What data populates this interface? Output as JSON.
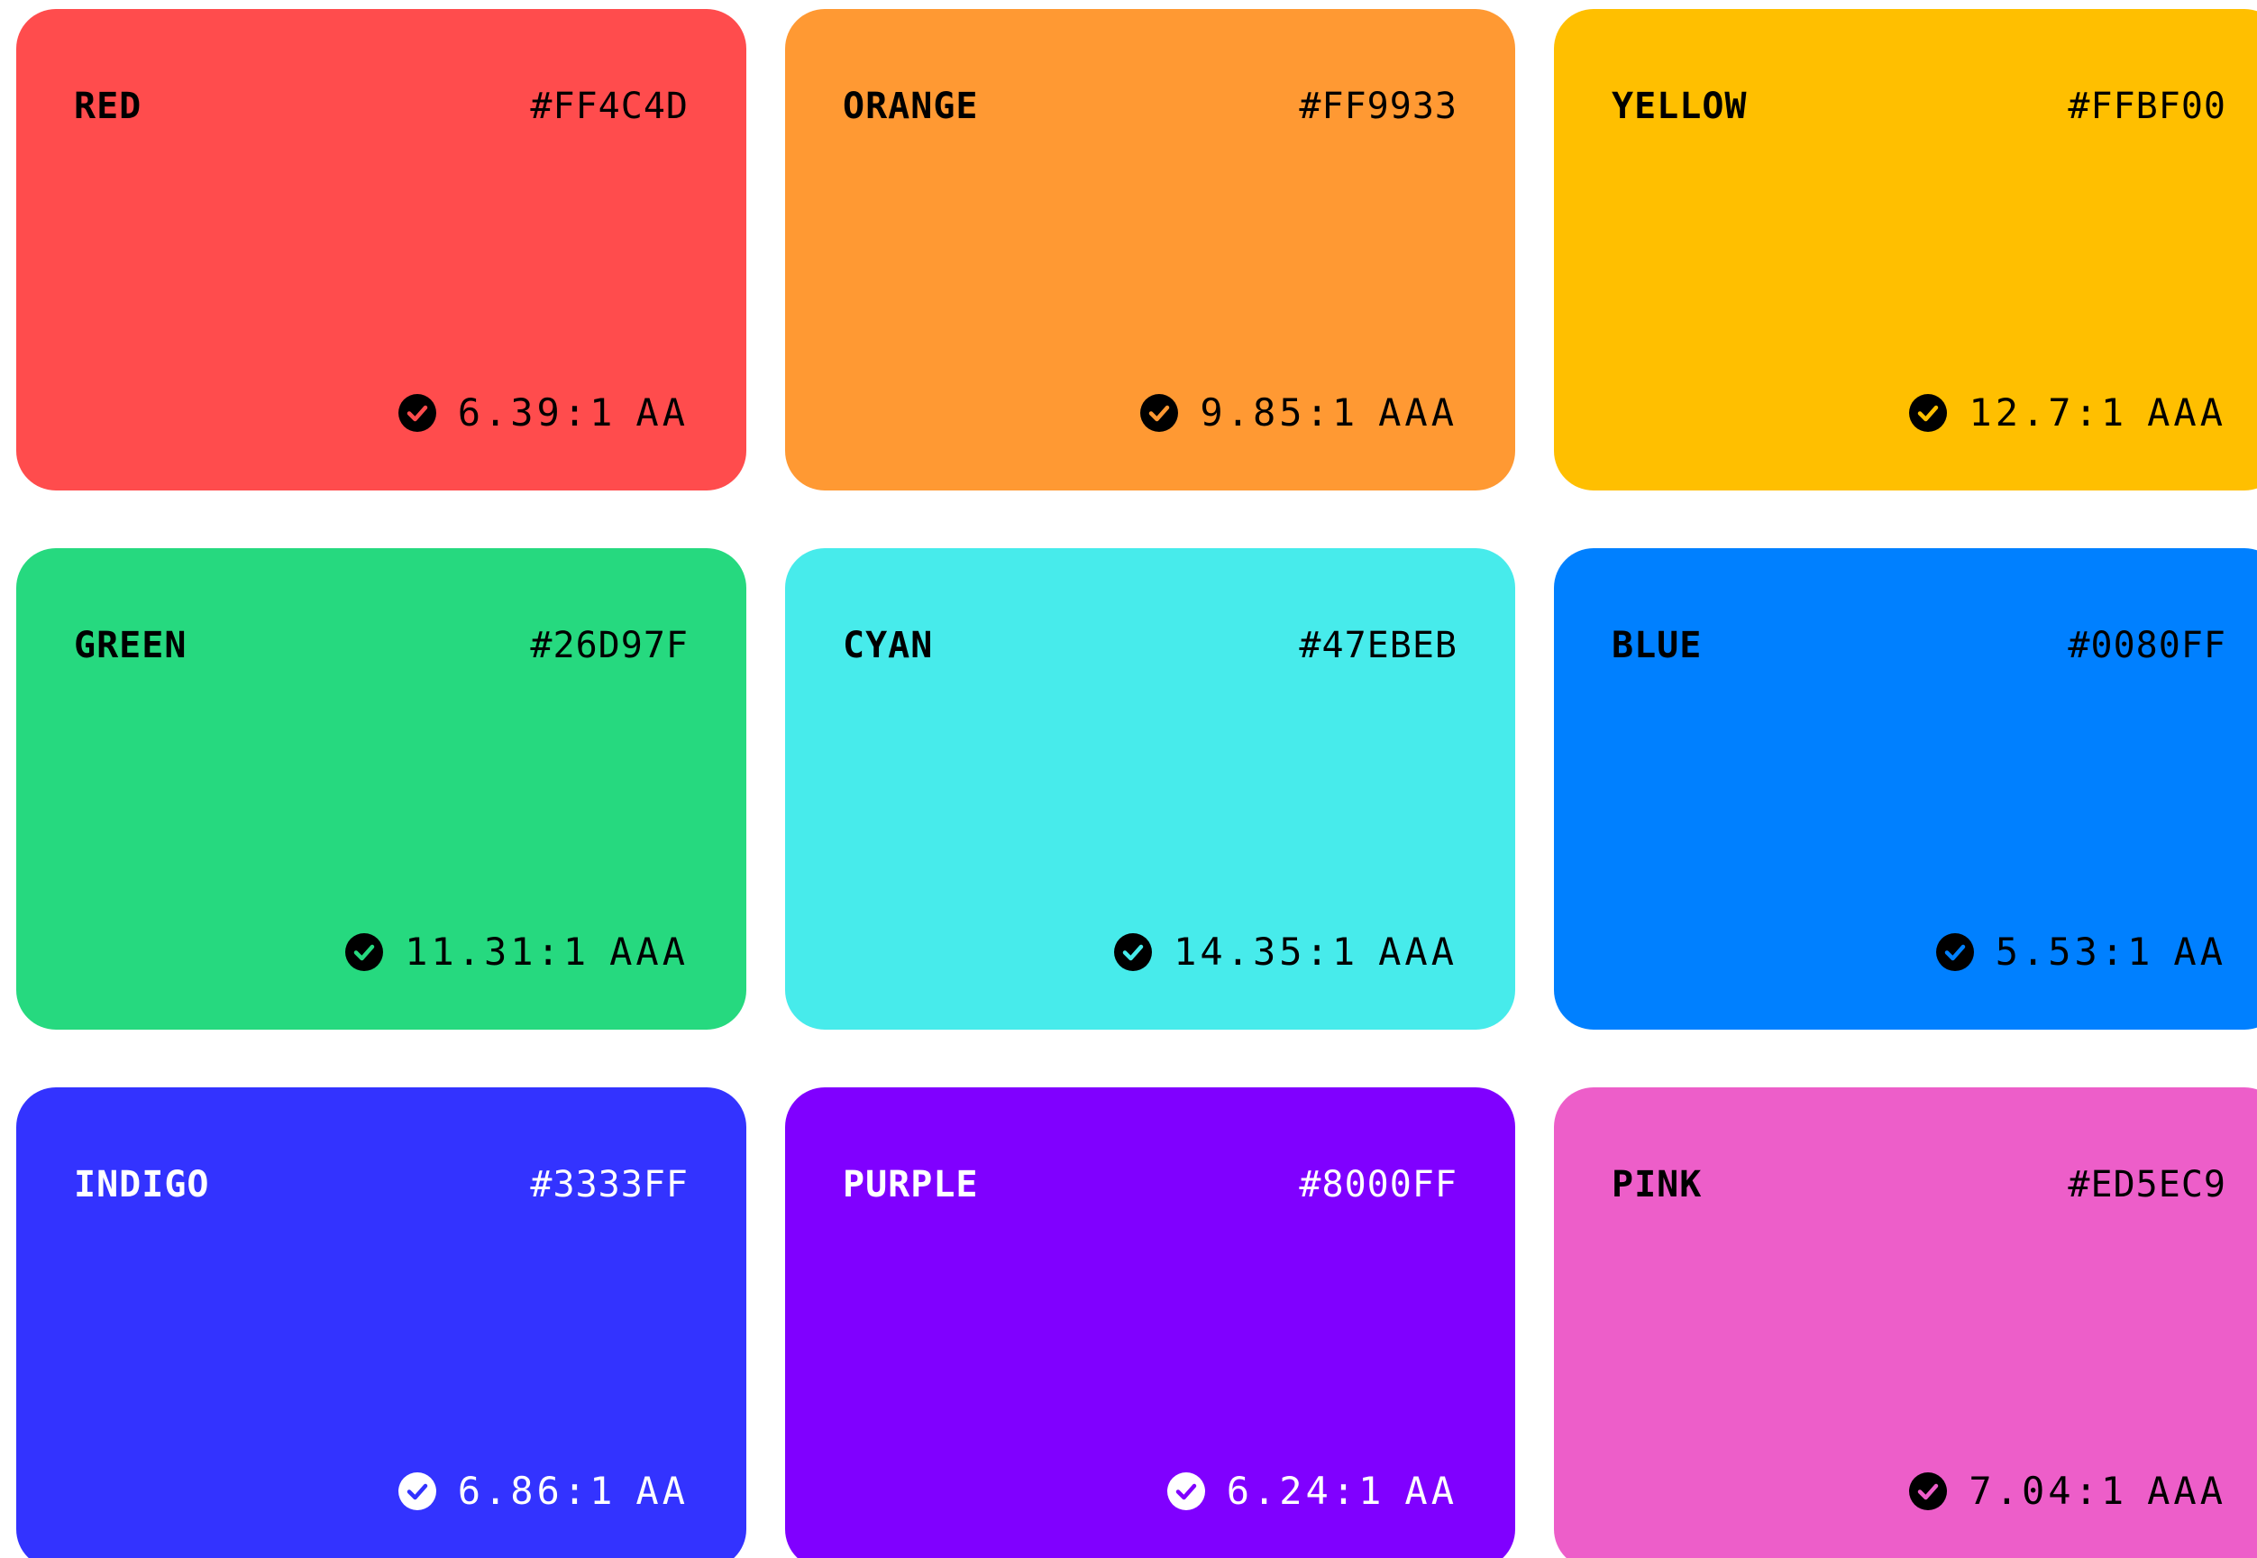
{
  "colors": [
    {
      "name": "RED",
      "hex": "#FF4C4D",
      "ratio": "6.39:1",
      "level": "AA",
      "bg": "#FF4C4D",
      "fg": "#000000"
    },
    {
      "name": "ORANGE",
      "hex": "#FF9933",
      "ratio": "9.85:1",
      "level": "AAA",
      "bg": "#FF9933",
      "fg": "#000000"
    },
    {
      "name": "YELLOW",
      "hex": "#FFBF00",
      "ratio": "12.7:1",
      "level": "AAA",
      "bg": "#FFBF00",
      "fg": "#000000"
    },
    {
      "name": "GREEN",
      "hex": "#26D97F",
      "ratio": "11.31:1",
      "level": "AAA",
      "bg": "#26D97F",
      "fg": "#000000"
    },
    {
      "name": "CYAN",
      "hex": "#47EBEB",
      "ratio": "14.35:1",
      "level": "AAA",
      "bg": "#47EBEB",
      "fg": "#000000"
    },
    {
      "name": "BLUE",
      "hex": "#0080FF",
      "ratio": "5.53:1",
      "level": "AA",
      "bg": "#0080FF",
      "fg": "#000000"
    },
    {
      "name": "INDIGO",
      "hex": "#3333FF",
      "ratio": "6.86:1",
      "level": "AA",
      "bg": "#3333FF",
      "fg": "#FFFFFF"
    },
    {
      "name": "PURPLE",
      "hex": "#8000FF",
      "ratio": "6.24:1",
      "level": "AA",
      "bg": "#8000FF",
      "fg": "#FFFFFF"
    },
    {
      "name": "PINK",
      "hex": "#ED5EC9",
      "ratio": "7.04:1",
      "level": "AAA",
      "bg": "#ED5EC9",
      "fg": "#000000"
    }
  ],
  "icons": {
    "contrast_pass": "check-circle-icon"
  }
}
